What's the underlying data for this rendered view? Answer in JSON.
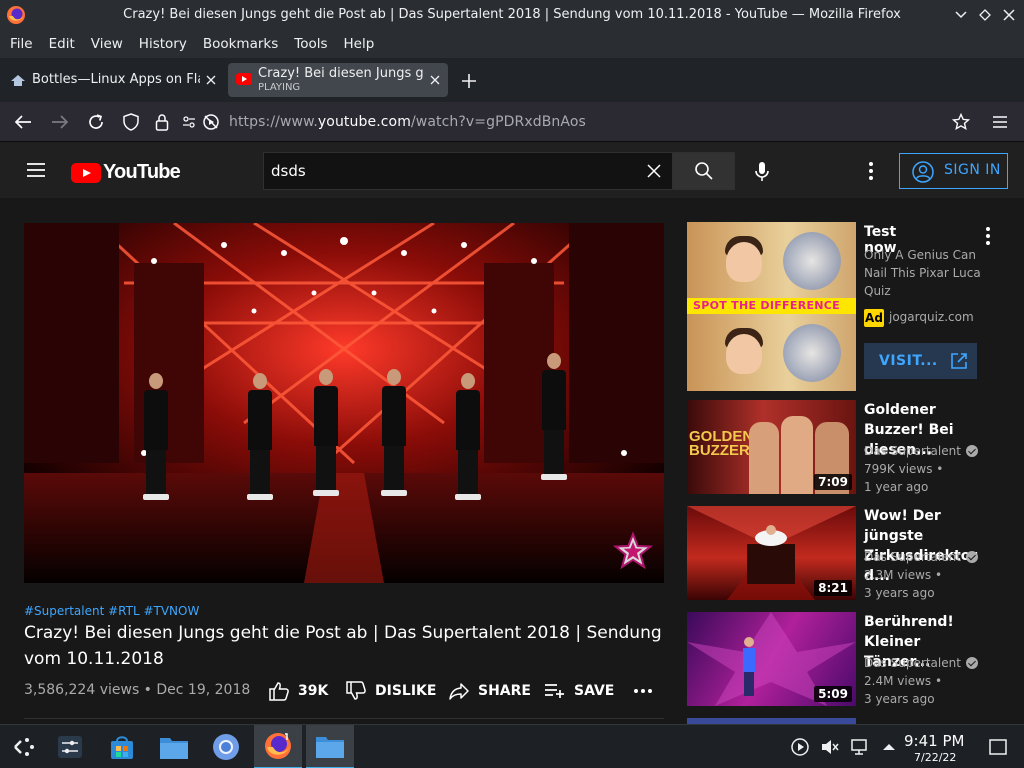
{
  "window": {
    "title": "Crazy! Bei diesen Jungs geht die Post ab | Das Supertalent 2018 | Sendung vom 10.11.2018 - YouTube — Mozilla Firefox"
  },
  "menu": [
    "File",
    "Edit",
    "View",
    "History",
    "Bookmarks",
    "Tools",
    "Help"
  ],
  "tabs": [
    {
      "title": "Bottles—Linux Apps on Fla",
      "icon": "bottles-icon"
    },
    {
      "title": "Crazy! Bei diesen Jungs geh",
      "subtitle": "PLAYING",
      "icon": "youtube-icon"
    }
  ],
  "address": {
    "prefix": "https://www.",
    "domain": "youtube.com",
    "path": "/watch?v=gPDRxdBnAos"
  },
  "youtube": {
    "logo_text": "YouTube",
    "search_value": "dsds",
    "sign_in": "SIGN IN"
  },
  "video": {
    "tags": "#Supertalent #RTL #TVNOW",
    "title": "Crazy! Bei diesen Jungs geht die Post ab | Das Supertalent 2018 | Sendung vom 10.11.2018",
    "meta": "3,586,224 views • Dec 19, 2018",
    "likes": "39K",
    "dislike": "DISLIKE",
    "share": "SHARE",
    "save": "SAVE"
  },
  "ad": {
    "title": "Test now",
    "description": "Only A Genius Can Nail This Pixar Luca Quiz",
    "badge": "Ad",
    "domain": "jogarquiz.com",
    "visit": "VISIT...",
    "thumb_banner": "SPOT THE DIFFERENCE"
  },
  "recommendations": [
    {
      "title": "Goldener Buzzer! Bei diesen...",
      "channel": "Das Supertalent",
      "views": "799K views •",
      "age": "1 year ago",
      "duration": "7:09",
      "thumb_text": "GOLDEN BUZZER"
    },
    {
      "title": "Wow! Der jüngste Zirkusdirektor d...",
      "channel": "Das Supertalent",
      "views": "2.3M views •",
      "age": "3 years ago",
      "duration": "8:21"
    },
    {
      "title": "Berührend! Kleiner Tänzer...",
      "channel": "Das Supertalent",
      "views": "2.4M views •",
      "age": "3 years ago",
      "duration": "5:09"
    }
  ],
  "clock": {
    "time": "9:41 PM",
    "date": "7/22/22"
  },
  "colors": {
    "accent": "#3ea6ff",
    "youtube_red": "#ff0000",
    "kde_blue": "#3daee9"
  }
}
